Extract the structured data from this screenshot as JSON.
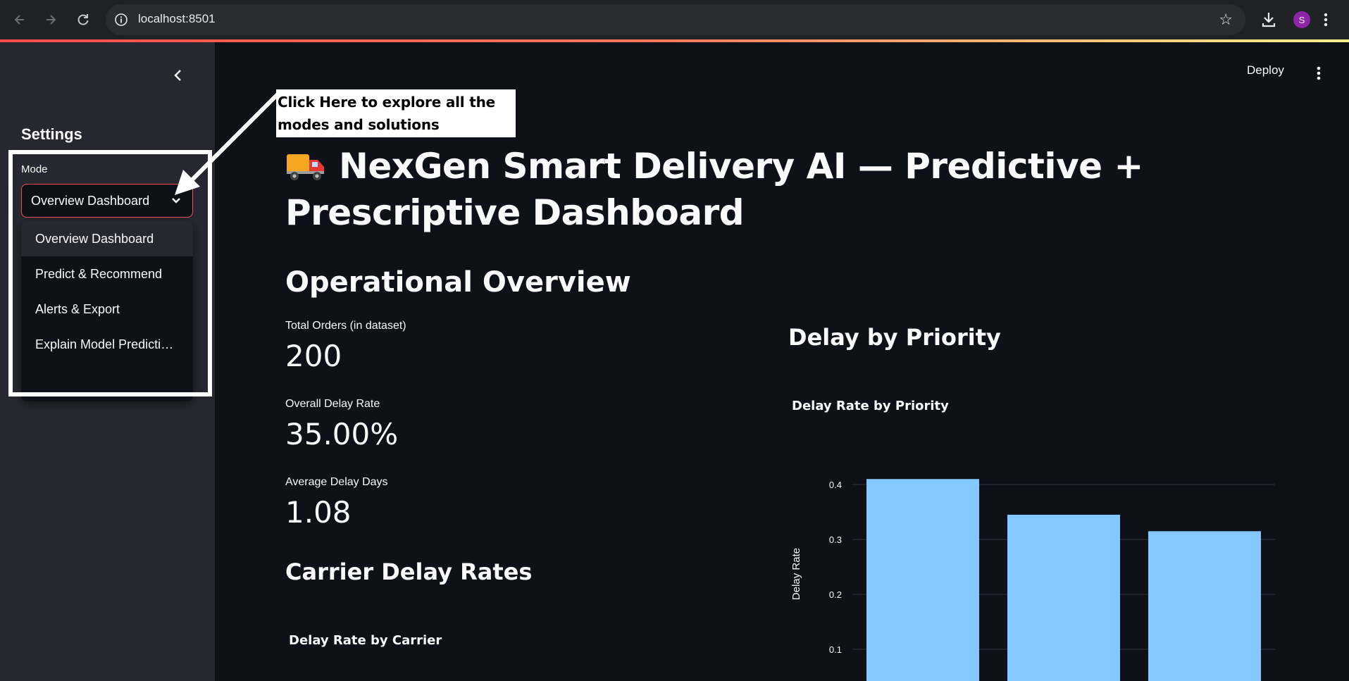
{
  "browser": {
    "url": "localhost:8501",
    "profile_initial": "S"
  },
  "sidebar": {
    "title": "Settings",
    "mode_label": "Mode",
    "selected": "Overview Dashboard",
    "options": [
      "Overview Dashboard",
      "Predict & Recommend",
      "Alerts & Export",
      "Explain Model Predictions"
    ]
  },
  "annotation": {
    "line1": "Click Here to explore all the",
    "line2": "modes and solutions"
  },
  "header": {
    "deploy_label": "Deploy"
  },
  "main": {
    "title": "NexGen Smart Delivery AI — Predictive + Prescriptive Dashboard",
    "operational_overview": "Operational Overview",
    "metrics": [
      {
        "label": "Total Orders (in dataset)",
        "value": "200"
      },
      {
        "label": "Overall Delay Rate",
        "value": "35.00%"
      },
      {
        "label": "Average Delay Days",
        "value": "1.08"
      }
    ],
    "carrier_heading": "Carrier Delay Rates",
    "carrier_chart_title": "Delay Rate by Carrier",
    "priority_heading": "Delay by Priority"
  },
  "colors": {
    "accent": "#ff4b4b",
    "bar": "#83c9ff",
    "background": "#0e1117",
    "sidebar": "#262730"
  },
  "chart_data": {
    "type": "bar",
    "title": "Delay Rate by Priority",
    "ylabel": "Delay Rate",
    "xlabel": "",
    "values": [
      0.41,
      0.345,
      0.315
    ],
    "yticks": [
      0.1,
      0.2,
      0.3,
      0.4
    ],
    "ylim": [
      0,
      0.43
    ],
    "grid": true
  }
}
